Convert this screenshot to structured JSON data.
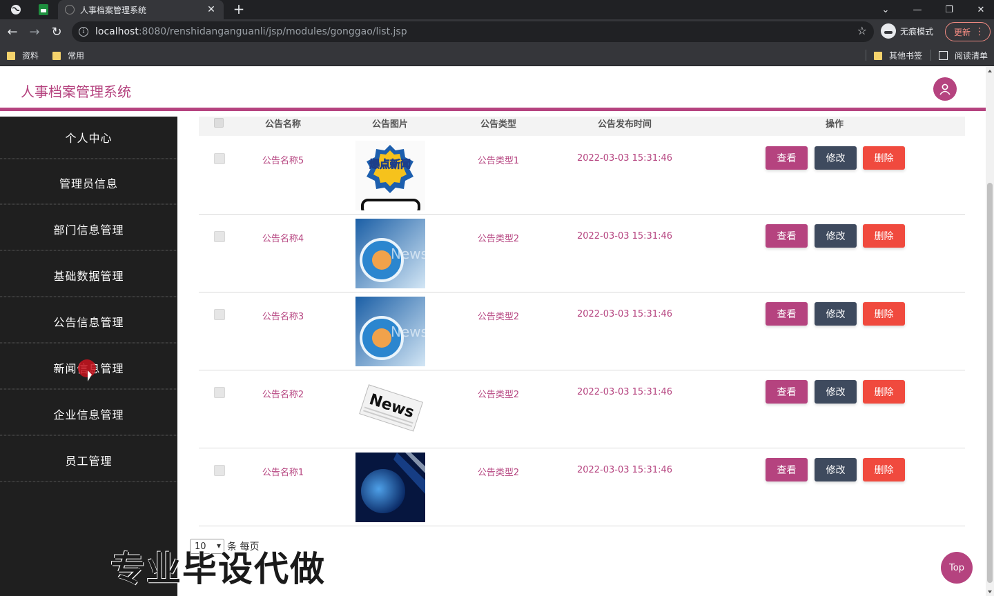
{
  "browser": {
    "tab_title": "人事档案管理系统",
    "url_host": "localhost",
    "url_rest": ":8080/renshidanganguanli/jsp/modules/gonggao/list.jsp",
    "incognito_label": "无痕模式",
    "update_label": "更新",
    "bookmarks": [
      "资料",
      "常用"
    ],
    "bookmarks_right": [
      "其他书签",
      "阅读清单"
    ]
  },
  "app": {
    "title": "人事档案管理系统"
  },
  "sidebar": {
    "items": [
      {
        "label": "个人中心"
      },
      {
        "label": "管理员信息"
      },
      {
        "label": "部门信息管理"
      },
      {
        "label": "基础数据管理"
      },
      {
        "label": "公告信息管理"
      },
      {
        "label": "新闻信息管理"
      },
      {
        "label": "企业信息管理"
      },
      {
        "label": "员工管理"
      }
    ]
  },
  "table": {
    "headers": {
      "name": "公告名称",
      "image": "公告图片",
      "type": "公告类型",
      "time": "公告发布时间",
      "ops": "操作"
    },
    "rows": [
      {
        "name": "公告名称5",
        "type": "公告类型1",
        "time": "2022-03-03 15:31:46",
        "image": "breaking-news-phone"
      },
      {
        "name": "公告名称4",
        "type": "公告类型2",
        "time": "2022-03-03 15:31:46",
        "image": "news-globe-blue"
      },
      {
        "name": "公告名称3",
        "type": "公告类型2",
        "time": "2022-03-03 15:31:46",
        "image": "news-globe-blue"
      },
      {
        "name": "公告名称2",
        "type": "公告类型2",
        "time": "2022-03-03 15:31:46",
        "image": "news-paper"
      },
      {
        "name": "公告名称1",
        "type": "公告类型2",
        "time": "2022-03-03 15:31:46",
        "image": "news-globe-dark"
      }
    ],
    "buttons": {
      "view": "查看",
      "edit": "修改",
      "delete": "删除"
    }
  },
  "pager": {
    "page_size": "10",
    "label": "条 每页"
  },
  "watermark": "专业毕设代做",
  "top_button": "Top",
  "thumb_text": {
    "breaking": "爆点新闻",
    "news": "News"
  },
  "colors": {
    "accent": "#b5437f",
    "edit": "#3e4a5e",
    "delete": "#f04a3e",
    "sidebar": "#1f1f1f"
  }
}
